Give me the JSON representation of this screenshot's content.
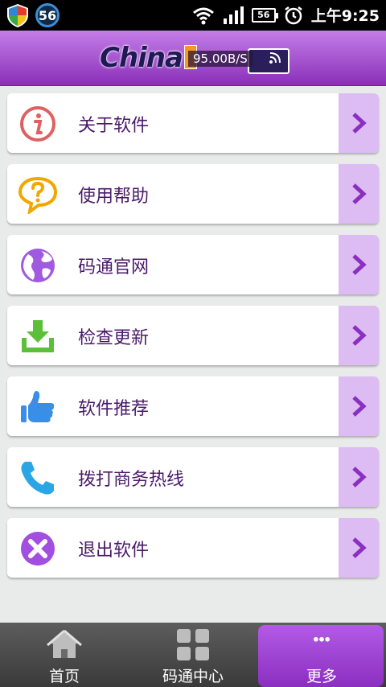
{
  "status_bar": {
    "notification_badge": "56",
    "battery_level": "56",
    "time": "上午9:25"
  },
  "header": {
    "logo_text": "China",
    "net_speed": "95.00B/S"
  },
  "menu": {
    "items": [
      {
        "label": "关于软件",
        "icon": "info-icon"
      },
      {
        "label": "使用帮助",
        "icon": "help-icon"
      },
      {
        "label": "码通官网",
        "icon": "globe-icon"
      },
      {
        "label": "检查更新",
        "icon": "download-icon"
      },
      {
        "label": "软件推荐",
        "icon": "thumbs-up-icon"
      },
      {
        "label": "拨打商务热线",
        "icon": "phone-icon"
      },
      {
        "label": "退出软件",
        "icon": "close-icon"
      }
    ]
  },
  "tabs": [
    {
      "label": "首页",
      "icon": "home-icon"
    },
    {
      "label": "码通中心",
      "icon": "grid-icon"
    },
    {
      "label": "更多",
      "icon": "more-icon",
      "active": true
    }
  ],
  "colors": {
    "accent": "#8a2fb8",
    "arrow_bg": "#dcbcf3",
    "label_text": "#4a1a6a"
  }
}
